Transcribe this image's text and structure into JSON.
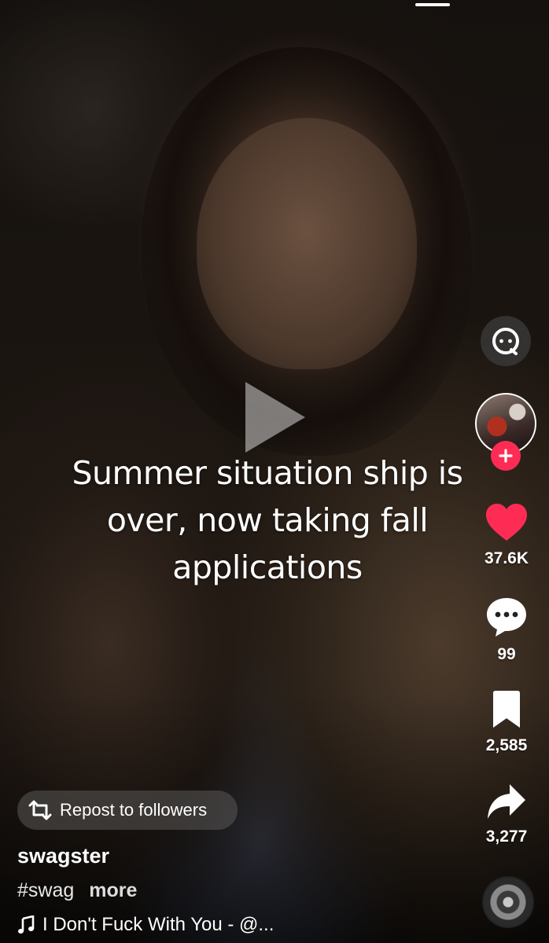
{
  "video": {
    "caption_lines": [
      "Summer situation ship is",
      "over, now taking fall",
      "applications"
    ]
  },
  "actions": {
    "likes": "37.6K",
    "comments": "99",
    "saves": "2,585",
    "shares": "3,277",
    "like_color": "#fe2c55"
  },
  "repost": {
    "label": "Repost to followers"
  },
  "post": {
    "username": "swagster",
    "hashtag": "#swag",
    "more_label": "more",
    "music": "I Don't Fuck With You - @..."
  },
  "icons": {
    "play": "play-icon",
    "ai": "ai-search-icon",
    "follow": "plus-icon",
    "like": "heart-icon",
    "comment": "comment-bubble-icon",
    "save": "bookmark-icon",
    "share": "share-arrow-icon",
    "repost": "repost-icon",
    "music": "music-note-icon",
    "disc": "music-disc-icon"
  }
}
